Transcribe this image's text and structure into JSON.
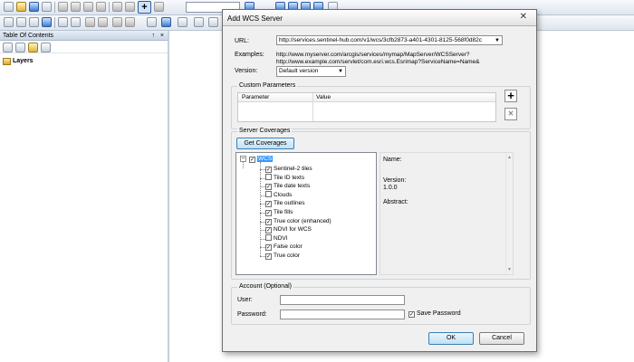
{
  "toc": {
    "title": "Table Of Contents",
    "pin": "↑",
    "close": "×",
    "layers_label": "Layers"
  },
  "toolbar": {
    "add_data_label": "+"
  },
  "dialog": {
    "title": "Add WCS Server",
    "close": "✕",
    "url_label": "URL:",
    "url_value": "http://services.sentinel-hub.com/v1/wcs/3cfb2873-a401-4301-8125-568f0d82c",
    "examples_label": "Examples:",
    "examples": [
      "http://www.myserver.com/arcgis/services/mymap/MapServer/WCSServer?",
      "http://www.example.com/servlet/com.esri.wcs.Esrimap?ServiceName=Name&"
    ],
    "version_label": "Version:",
    "version_value": "Default version",
    "custom_params": {
      "title": "Custom Parameters",
      "col_parameter": "Parameter",
      "col_value": "Value",
      "add_icon": "+",
      "remove_icon": "✕"
    },
    "coverages": {
      "title": "Server Coverages",
      "get_button": "Get Coverages",
      "root": {
        "label": "WCS",
        "checked": true,
        "expander": "−"
      },
      "items": [
        {
          "label": "Sentinel-2 tiles",
          "checked": true
        },
        {
          "label": "Tile ID texts",
          "checked": false
        },
        {
          "label": "Tile date texts",
          "checked": true
        },
        {
          "label": "Clouds",
          "checked": false
        },
        {
          "label": "Tile outlines",
          "checked": true
        },
        {
          "label": "Tile fills",
          "checked": true
        },
        {
          "label": "True color (enhanced)",
          "checked": true
        },
        {
          "label": "NDVI for WCS",
          "checked": true
        },
        {
          "label": "NDVI",
          "checked": false
        },
        {
          "label": "False color",
          "checked": true
        },
        {
          "label": "True color",
          "checked": true
        }
      ],
      "info": {
        "name_label": "Name:",
        "version_label": "Version:",
        "version_value": "1.0.0",
        "abstract_label": "Abstract:"
      }
    },
    "account": {
      "title": "Account (Optional)",
      "user_label": "User:",
      "password_label": "Password:",
      "save_password_label": "Save Password",
      "save_password_checked": true
    },
    "ok_label": "OK",
    "cancel_label": "Cancel"
  }
}
